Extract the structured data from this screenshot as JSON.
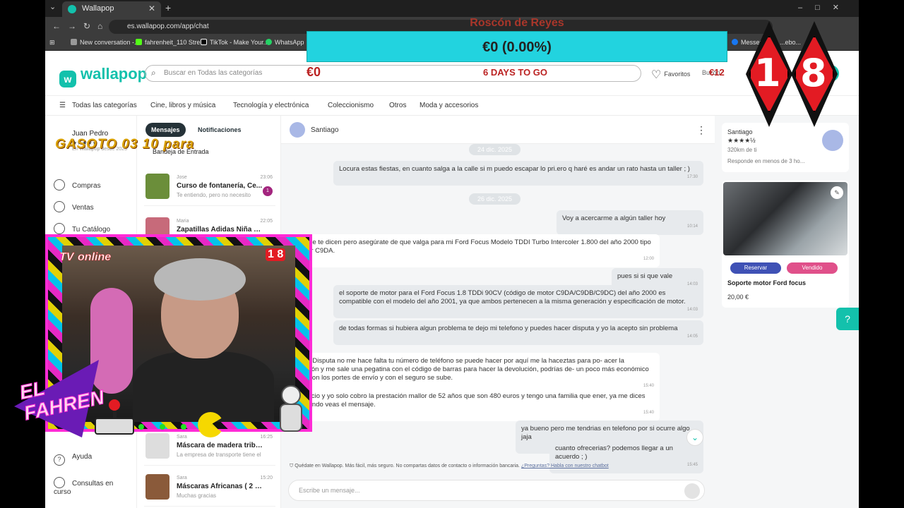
{
  "browser": {
    "tab_title": "Wallapop",
    "url": "es.wallapop.com/app/chat",
    "bookmarks": [
      "New conversation -...",
      "fahrenheit_110 Stre...",
      "TikTok - Make Your...",
      "WhatsApp",
      "Messer",
      "...ebo..."
    ]
  },
  "overlay": {
    "title": "Roscón de Reyes",
    "progress": "€0 (0.00%)",
    "amount_left": "€0",
    "days": "6 DAYS TO GO",
    "amount_right": "€12",
    "ticker": "GASOTO 03 10 para",
    "rating_digit_1": "1",
    "rating_digit_2": "8",
    "cam_label_1": "TV",
    "cam_label_2": "online",
    "cam_badge": "1 8",
    "logo_text_1": "EL",
    "logo_text_2": "FAHREN"
  },
  "header": {
    "logo": "wallapop",
    "search_placeholder": "Buscar en Todas las categorías",
    "favorites": "Favoritos",
    "inbox": "Buzón"
  },
  "categories": [
    "Todas las categorías",
    "Cine, libros y música",
    "Tecnología y electrónica",
    "Coleccionismo",
    "Otros",
    "Moda y accesorios"
  ],
  "sidebar": {
    "user_name": "Juan Pedro",
    "stars": "★★★★★",
    "since": "En Wallapop desde 2023",
    "items": [
      "Compras",
      "Ventas",
      "Tu Catálogo",
      "Ayuda",
      "Consultas en curso"
    ]
  },
  "conversations": {
    "tab_messages": "Mensajes",
    "tab_notifications": "Notificaciones",
    "inbox_label": "Bandeja de Entrada",
    "items": [
      {
        "user": "Jose",
        "time": "23:06",
        "title": "Curso de fontanería, Ce...",
        "snippet": "Te entiendo, pero no necesito",
        "badge": "1"
      },
      {
        "user": "Maria",
        "time": "22:05",
        "title": "Zapatillas Adidas Niña Rosa...",
        "snippet": "",
        "badge": ""
      },
      {
        "user": "Sara",
        "time": "16:25",
        "title": "Máscara de madera tribal af...",
        "snippet": "La empresa de transporte tiene el",
        "badge": ""
      },
      {
        "user": "Sara",
        "time": "15:20",
        "title": "Máscaras Africanas ( 2 unid...",
        "snippet": "Muchas gracias",
        "badge": ""
      }
    ]
  },
  "chat": {
    "contact": "Santiago",
    "date_1": "24 dic. 2025",
    "date_2": "26 dic. 2025",
    "messages": [
      {
        "text": "Locura estas fiestas, en cuanto salga a la calle si m puedo escapar lo pri.ero q haré es andar un rato hasta un taller ; )",
        "time": "17:30"
      },
      {
        "text": "Voy a acercarme a algún taller hoy",
        "time": "10:14"
      },
      {
        "text": "ver lo que te dicen pero asegúrate de que valga para mi Ford Focus Modelo TDDI Turbo Intercoler 1.800 del año 2000 tipo de Motor C9DA.",
        "time": "12:00"
      },
      {
        "text": "pues si si que vale",
        "time": "14:03"
      },
      {
        "text": "el soporte de motor para el Ford Focus 1.8 TDDi 90CV (código de motor C9DA/C9DB/C9DC) del año 2000 es compatible con el modelo del año 2001, ya que ambos pertenecen a la misma generación y especificación de motor.",
        "time": "14:03"
      },
      {
        "text": "de todas formas si hubiera algun problema te dejo mi telefono y puedes hacer disputa y yo la acepto sin problema",
        "time": "14:05"
      },
      {
        "text": "hacer la Disputa no me hace falta tu número de teléfono se puede hacer por aquí me la haceztas para po- acer la devolución y me sale una pegatina con el código de barras para hacer la devolución, podrías de- un poco más económico es que con los portes de envío y con el seguro se sube.",
        "time": "15:40"
      },
      {
        "text": "o de precio y yo solo cobro la prestación mallor de 52 años que son 480 euros y tengo una familia que ener, ya me dices algo cuando veas el mensaje.",
        "time": "15:40"
      },
      {
        "text": "ya bueno pero me tendrias en telefono por si ocurre algo jaja",
        "time": "15:44"
      },
      {
        "text": "cuanto ofrecerias? podemos llegar a un acuerdo ; )",
        "time": "15:45"
      }
    ],
    "safety_text": "Quédate en Wallapop. Más fácil, más seguro. No compartas datos de contacto o información bancaria.",
    "safety_link": "¿Preguntas? Habla con nuestro chatbot",
    "compose_placeholder": "Escribe un mensaje..."
  },
  "seller": {
    "name": "Santiago",
    "stars": "★★★★½",
    "distance": "320km de ti",
    "response": "Responde en menos de 3 ho..."
  },
  "product": {
    "reserve": "Reservar",
    "sold": "Vendido",
    "title": "Soporte motor Ford focus",
    "price": "20,00 €"
  },
  "colors": {
    "brand": "#13c1ac",
    "overlay_bar": "#22d3df",
    "diamond": "#e31b23",
    "reserve_btn": "#3f51b5",
    "sold_btn": "#e0508a"
  }
}
